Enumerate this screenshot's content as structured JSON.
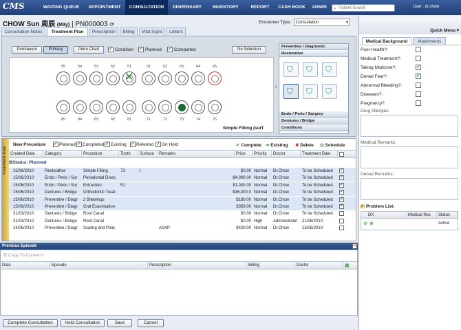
{
  "app": {
    "logo": "CMS",
    "user": "User : dr.chow"
  },
  "nav": [
    "WAITING QUEUE",
    "APPOINTMENT",
    "CONSULTATION",
    "DISPENSARY",
    "INVENTORY",
    "REPORT",
    "CASH BOOK",
    "ADMIN"
  ],
  "search_placeholder": "Patient Search",
  "patient": {
    "name": "CHOW Sun 周辰",
    "age": "(M3y)",
    "id": "| PN000003"
  },
  "encounter": {
    "label": "Encounter Type:",
    "value": "Consultation"
  },
  "tabs": [
    "Consultation Notes",
    "Treatment Plan",
    "Prescription",
    "Billing",
    "Vital Signs",
    "Letters"
  ],
  "chart_tools": {
    "permanent": "Permanent",
    "primary": "Primary",
    "perio": "Perio Chart",
    "condition": "Condition",
    "planned": "Planned",
    "completed": "Completed",
    "no_selection": "No Selection"
  },
  "upper_teeth": [
    "55",
    "54",
    "53",
    "52",
    "51",
    "61",
    "62",
    "63",
    "64",
    "65"
  ],
  "lower_teeth": [
    "85",
    "84",
    "83",
    "82",
    "81",
    "71",
    "72",
    "73",
    "74",
    "75"
  ],
  "selected_procedure": "Simple Filling (surf",
  "proc_panel": {
    "preventive": "Preventive / Diagnostic",
    "restorative": "Restorative",
    "endo": "Endo / Perio / Surgery",
    "dentures": "Dentures / Bridge",
    "conditions": "Conditions"
  },
  "tp": {
    "side_label": "Treatment Plan",
    "new_procedure": "New Procedure",
    "filters": [
      "Planned",
      "Completed",
      "Existing",
      "Referred",
      "On Hold"
    ],
    "actions": {
      "complete": "Complete",
      "existing": "Existing",
      "delete": "Delete",
      "schedule": "Schedule"
    },
    "columns": [
      "Created Date",
      "Category",
      "Procedure",
      "Tooth",
      "Surface",
      "Remarks",
      "Price",
      "Priority",
      "Doctor",
      "Treatment Date"
    ],
    "group": "Status: Planned",
    "rows": [
      {
        "date": "15/06/2010",
        "cat": "Restorative",
        "proc": "Simple Filling",
        "tooth": "73",
        "surf": "I",
        "rem": "",
        "price": "$0.00",
        "prio": "Normal",
        "doc": "Dr.Chow",
        "tdate": "To be Scheduled"
      },
      {
        "date": "15/06/2010",
        "cat": "Endo / Perio / Sur",
        "proc": "Periodontal Dises",
        "tooth": "",
        "surf": "",
        "rem": "",
        "price": "$4,000.00",
        "prio": "Normal",
        "doc": "Dr.Chow",
        "tdate": "To be Scheduled"
      },
      {
        "date": "15/06/2010",
        "cat": "Endo / Perio / Sur",
        "proc": "Extraction",
        "tooth": "51",
        "surf": "",
        "rem": "",
        "price": "$1,000.00",
        "prio": "Normal",
        "doc": "Dr.Chow",
        "tdate": "To be Scheduled"
      },
      {
        "date": "15/06/2010",
        "cat": "Dentures / Bridge",
        "proc": "Orthodontic Treat",
        "tooth": "",
        "surf": "",
        "rem": "",
        "price": "$36,000.0",
        "prio": "Normal",
        "doc": "Dr.Chow",
        "tdate": "To be Scheduled"
      },
      {
        "date": "15/06/2010",
        "cat": "Preventive / Diagr",
        "proc": "2 Bitewings",
        "tooth": "",
        "surf": "",
        "rem": "",
        "price": "$180.00",
        "prio": "Normal",
        "doc": "Dr.Chow",
        "tdate": "To be Scheduled"
      },
      {
        "date": "15/06/2010",
        "cat": "Preventive / Diagr",
        "proc": "Oral Examination",
        "tooth": "",
        "surf": "",
        "rem": "",
        "price": "$350.00",
        "prio": "Normal",
        "doc": "Dr.Chow",
        "tdate": "To be Scheduled"
      },
      {
        "date": "31/03/2010",
        "cat": "Dentures / Bridge",
        "proc": "Root Canal",
        "tooth": "",
        "surf": "",
        "rem": "",
        "price": "$0.00",
        "prio": "Normal",
        "doc": "Dr.Chow",
        "tdate": "To be Scheduled"
      },
      {
        "date": "31/03/2010",
        "cat": "Dentures / Bridge",
        "proc": "Root Canal",
        "tooth": "",
        "surf": "",
        "rem": "",
        "price": "$0.00",
        "prio": "High",
        "doc": "Administrator",
        "tdate": "21/06/2010"
      },
      {
        "date": "14/06/2010",
        "cat": "Preventive / Diagr",
        "proc": "Scaling and Polis",
        "tooth": "",
        "surf": "",
        "rem": "ASAP",
        "price": "$420.00",
        "prio": "Normal",
        "doc": "Dr.Chow",
        "tdate": "15/06/2010"
      }
    ]
  },
  "prev": {
    "title": "Previous Episode",
    "copy": "Copy To Current",
    "columns": [
      "Date",
      "Episode",
      "Prescription",
      "Billing",
      "Doctor"
    ]
  },
  "bottom": [
    "Complete Consultation",
    "Hold Consultation",
    "Save",
    "Cancel"
  ],
  "right": {
    "quick_menu": "Quick Menu",
    "tabs": [
      "Medical Background",
      "Attachments"
    ],
    "questions": [
      "Poor Health?:",
      "Medical Treatment?:",
      "Taking Medicine?:",
      "Dental Fear?:",
      "Abnormal Bleeding?:",
      "Diseases?:",
      "Pregnancy?:"
    ],
    "checked": [
      false,
      false,
      true,
      true,
      false,
      false,
      false
    ],
    "drug": "Drug Allergies:",
    "medical": "Medical Remarks:",
    "dental": "Dental Remarks:",
    "problem": "Problem List:",
    "problem_cols": [
      "DX",
      "Medical Rec",
      "Status"
    ],
    "problem_status": "Active"
  }
}
